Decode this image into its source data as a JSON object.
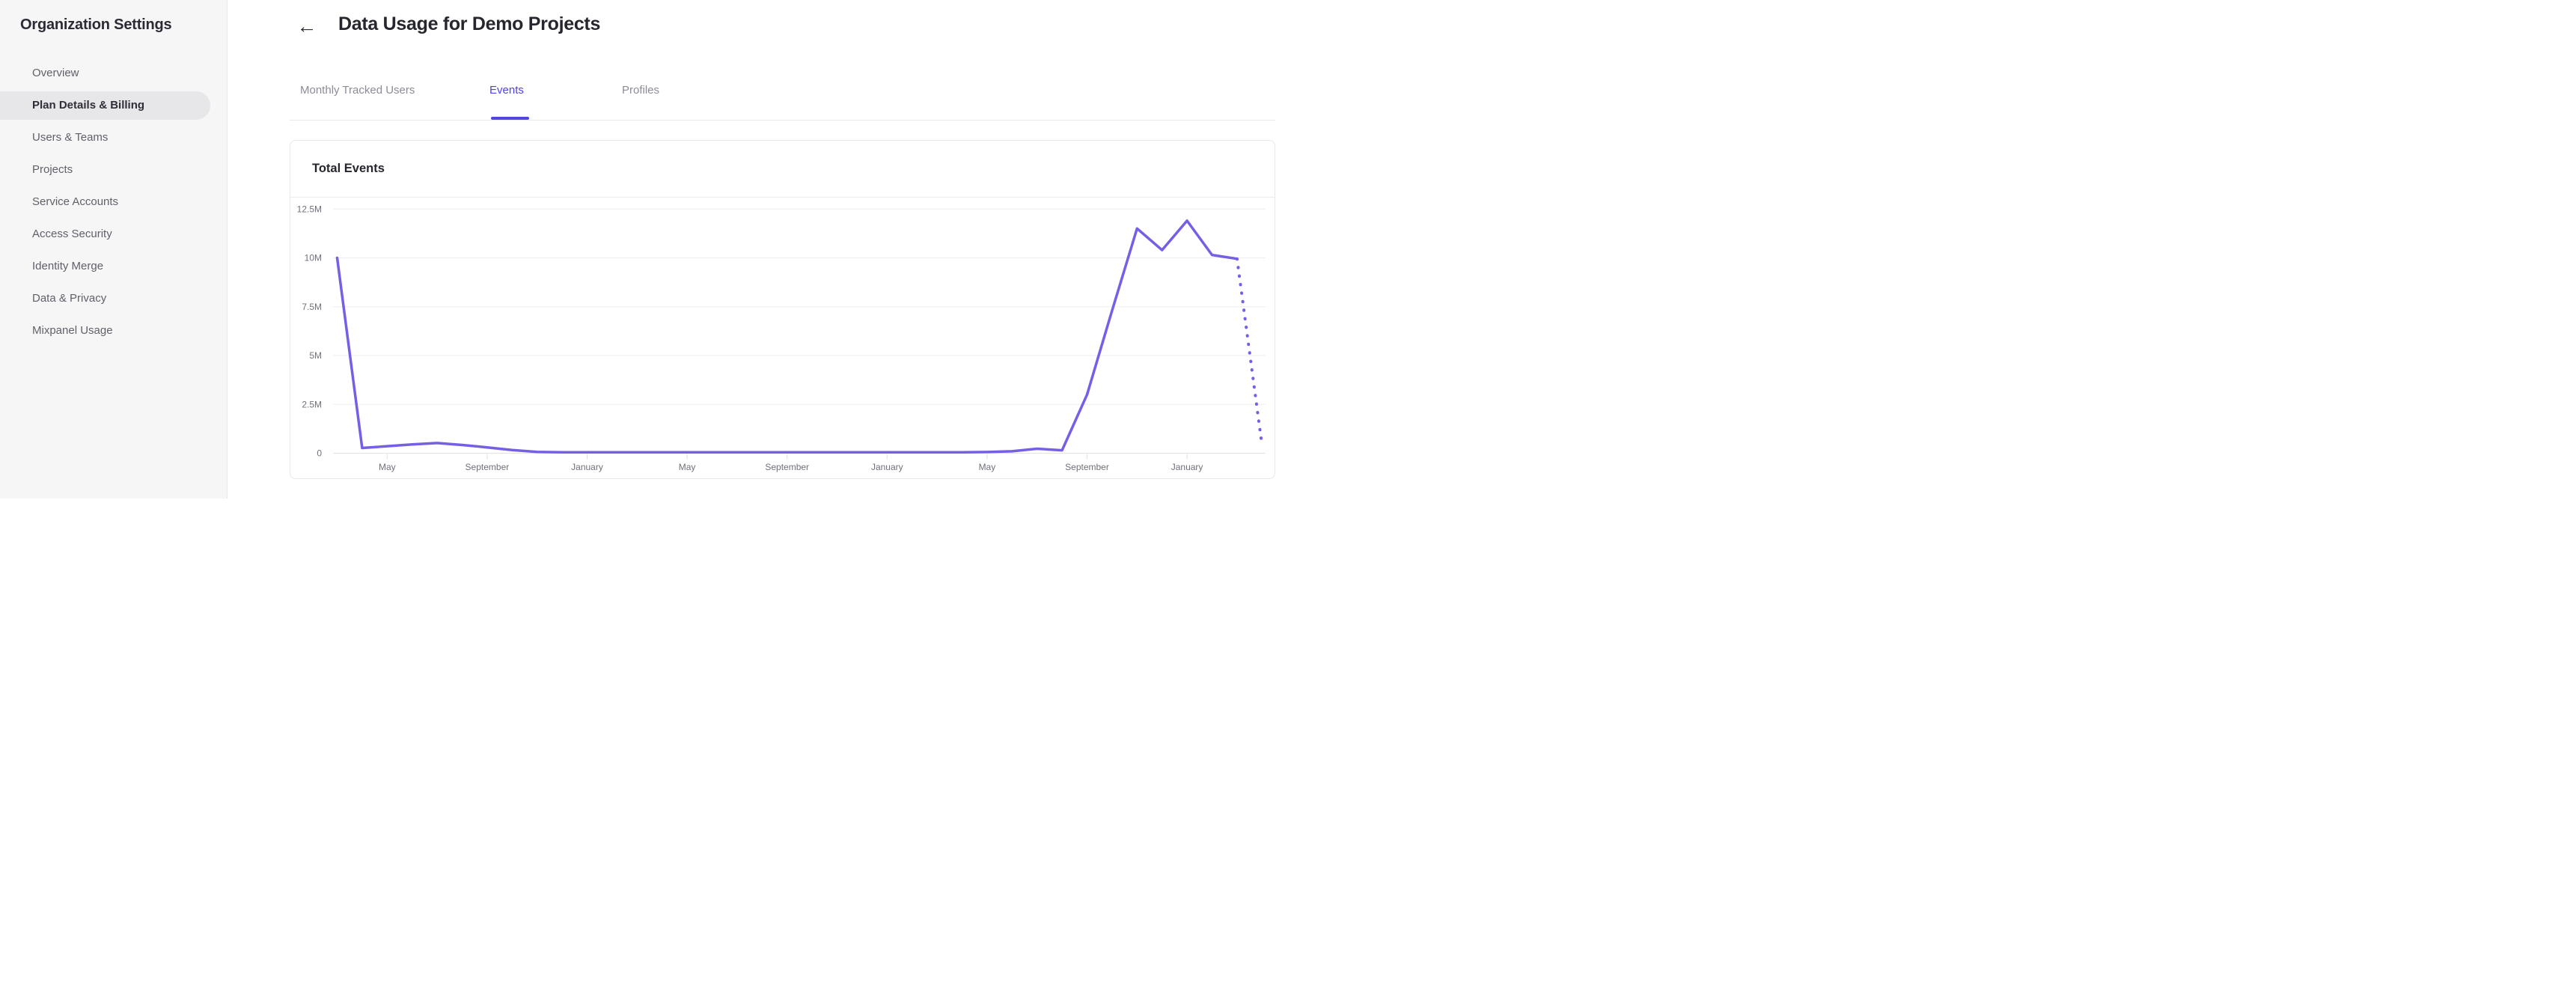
{
  "sidebar": {
    "title": "Organization Settings",
    "items": [
      {
        "label": "Overview",
        "active": false
      },
      {
        "label": "Plan Details & Billing",
        "active": true
      },
      {
        "label": "Users & Teams",
        "active": false
      },
      {
        "label": "Projects",
        "active": false
      },
      {
        "label": "Service Accounts",
        "active": false
      },
      {
        "label": "Access Security",
        "active": false
      },
      {
        "label": "Identity Merge",
        "active": false
      },
      {
        "label": "Data & Privacy",
        "active": false
      },
      {
        "label": "Mixpanel Usage",
        "active": false
      }
    ]
  },
  "header": {
    "back_icon": "←",
    "title": "Data Usage for Demo Projects"
  },
  "tabs": [
    {
      "label": "Monthly Tracked Users",
      "active": false
    },
    {
      "label": "Events",
      "active": true
    },
    {
      "label": "Profiles",
      "active": false
    }
  ],
  "card": {
    "title": "Total Events"
  },
  "colors": {
    "accent": "#4f44e0",
    "line": "#7460e6",
    "grid": "#ededf0",
    "zero_line": "#e2e2e6",
    "tick": "#e0e0e4",
    "axis_text": "#70707a"
  },
  "chart_data": {
    "type": "line",
    "title": "Total Events",
    "xlabel": "",
    "ylabel": "",
    "grid": "horizontal",
    "legend": false,
    "y_axis": {
      "tick_values_millions": [
        0,
        2.5,
        5,
        7.5,
        10,
        12.5
      ],
      "tick_labels": [
        "0",
        "2.5M",
        "5M",
        "7.5M",
        "10M",
        "12.5M"
      ],
      "ylim_millions": [
        0,
        13.2
      ]
    },
    "x_axis": {
      "unit": "month",
      "tick_month_indices": [
        2,
        6,
        10,
        14,
        18,
        22,
        26,
        30,
        34
      ],
      "tick_labels": [
        "May",
        "September",
        "January",
        "May",
        "September",
        "January",
        "May",
        "September",
        "January"
      ]
    },
    "series": [
      {
        "name": "Total Events",
        "color": "#7460e6",
        "unit": "millions",
        "values_millions": [
          10.0,
          0.27,
          0.36,
          0.45,
          0.52,
          0.42,
          0.3,
          0.16,
          0.07,
          0.05,
          0.05,
          0.05,
          0.05,
          0.05,
          0.05,
          0.05,
          0.05,
          0.05,
          0.05,
          0.05,
          0.05,
          0.05,
          0.05,
          0.05,
          0.05,
          0.05,
          0.06,
          0.1,
          0.23,
          0.15,
          3.0,
          7.3,
          11.5,
          10.4,
          11.9,
          10.15,
          9.95,
          0.4
        ],
        "projection_start_index": 36,
        "projection_style": "dotted"
      }
    ]
  }
}
